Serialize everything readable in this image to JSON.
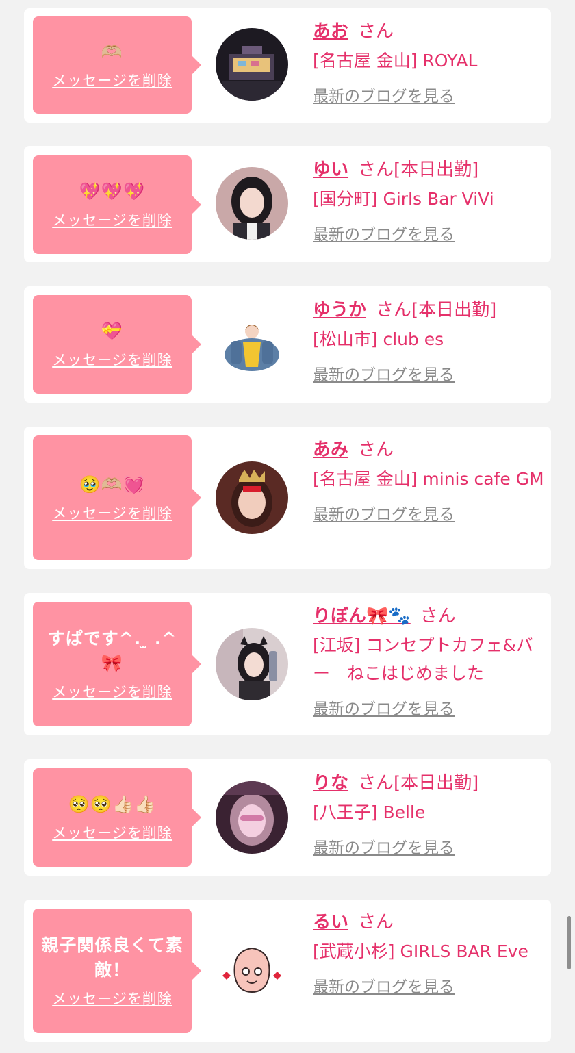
{
  "colors": {
    "bubble": "#ff93a3",
    "accent": "#e5306a",
    "blog_link": "#8a8a8a",
    "background": "#f2f2f2"
  },
  "cards": [
    {
      "message": "🫶🏼",
      "delete_label": "メッセージを削除",
      "name": "あお",
      "suffix": "さん",
      "shop": "[名古屋 金山] ROYAL",
      "blog_label": "最新のブログを見る"
    },
    {
      "message": "💖💖💖",
      "delete_label": "メッセージを削除",
      "name": "ゆい",
      "suffix": "さん[本日出勤]",
      "shop": "[国分町] Girls Bar ViVi",
      "blog_label": "最新のブログを見る"
    },
    {
      "message": "💝",
      "delete_label": "メッセージを削除",
      "name": "ゆうか",
      "suffix": "さん[本日出勤]",
      "shop": "[松山市] club es",
      "blog_label": "最新のブログを見る"
    },
    {
      "message": "🥹🫶🏼💓",
      "delete_label": "メッセージを削除",
      "name": "あみ",
      "suffix": "さん",
      "shop": "[名古屋 金山] minis cafe GM",
      "blog_label": "最新のブログを見る"
    },
    {
      "message": "すぱです^. ̫ .^🎀",
      "delete_label": "メッセージを削除",
      "name": "りぼん🎀🐾",
      "suffix": "さん",
      "shop": "[江坂] コンセプトカフェ&バー　ねこはじめました",
      "blog_label": "最新のブログを見る"
    },
    {
      "message": "🥺🥺👍🏻👍🏻",
      "delete_label": "メッセージを削除",
      "name": "りな",
      "suffix": "さん[本日出勤]",
      "shop": "[八王子] Belle",
      "blog_label": "最新のブログを見る"
    },
    {
      "message": "親子関係良くて素敵！",
      "delete_label": "メッセージを削除",
      "name": "るい",
      "suffix": "さん",
      "shop": "[武蔵小杉] GIRLS BAR Eve",
      "blog_label": "最新のブログを見る"
    }
  ]
}
